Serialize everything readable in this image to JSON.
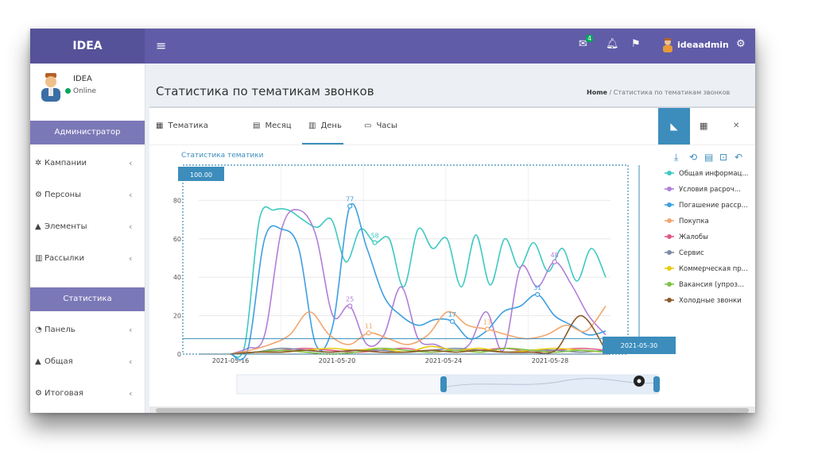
{
  "app": {
    "logo": "IDEA"
  },
  "topbar": {
    "mail_count": "4",
    "username": "ideaadmin"
  },
  "sidebar": {
    "user_name": "IDEA",
    "status": "Online",
    "section1": "Администратор",
    "items1": [
      {
        "label": "Кампании",
        "icon": "cubes-icon"
      },
      {
        "label": "Персоны",
        "icon": "gear-icon"
      },
      {
        "label": "Элементы",
        "icon": "warning-icon"
      },
      {
        "label": "Рассылки",
        "icon": "columns-icon"
      }
    ],
    "section2": "Статистика",
    "items2": [
      {
        "label": "Панель",
        "icon": "dashboard-icon"
      },
      {
        "label": "Общая",
        "icon": "warning-icon"
      },
      {
        "label": "Итоговая",
        "icon": "gear-icon"
      }
    ]
  },
  "content": {
    "page_title": "Статистика по тематикам звонков",
    "breadcrumb_home": "Home",
    "breadcrumb_current": "Статистика по тематикам звонков",
    "tabs": [
      "Тематика",
      "Месяц",
      "День",
      "Часы"
    ],
    "active_tab": "День"
  },
  "chart_data": {
    "type": "line",
    "title": "Статистика тематики",
    "x": [
      "2021-05-16",
      "2021-05-17",
      "2021-05-18",
      "2021-05-19",
      "2021-05-20",
      "2021-05-21",
      "2021-05-22",
      "2021-05-23",
      "2021-05-24",
      "2021-05-25",
      "2021-05-26",
      "2021-05-27",
      "2021-05-28",
      "2021-05-29",
      "2021-05-30"
    ],
    "xticks": [
      "2021-05-16",
      "2021-05-20",
      "2021-05-24",
      "2021-05-28"
    ],
    "ylim": [
      0,
      100
    ],
    "yticks": [
      0,
      20,
      40,
      60,
      80
    ],
    "zoom_start_label": "100.00",
    "zoom_end_label": "2021-05-30",
    "series": [
      {
        "name": "Общая информац...",
        "color": "#3ec9c1",
        "values": [
          0,
          5,
          70,
          75,
          75,
          70,
          66,
          70,
          48,
          65,
          58,
          60,
          35,
          65,
          55,
          60,
          35,
          62,
          36,
          60,
          45,
          58,
          43,
          55,
          38,
          55,
          40
        ]
      },
      {
        "name": "Условия расроч...",
        "color": "#b07fd8",
        "values": [
          0,
          3,
          10,
          65,
          75,
          62,
          20,
          25,
          5,
          10,
          35,
          8,
          5,
          2,
          5,
          22,
          2,
          45,
          35,
          48,
          36,
          20,
          10
        ]
      },
      {
        "name": "Погашение расср...",
        "color": "#3e9fe0",
        "values": [
          0,
          2,
          60,
          65,
          55,
          5,
          15,
          77,
          55,
          30,
          20,
          15,
          18,
          17,
          8,
          12,
          22,
          25,
          31,
          20,
          15,
          10,
          12
        ]
      },
      {
        "name": "Покупка",
        "color": "#f2a66e",
        "values": [
          0,
          2,
          5,
          10,
          22,
          10,
          5,
          11,
          8,
          5,
          10,
          22,
          15,
          13,
          10,
          8,
          10,
          15,
          12,
          25
        ]
      },
      {
        "name": "Жалобы",
        "color": "#e05a86",
        "values": [
          0,
          1,
          2,
          3,
          2,
          1,
          2,
          3,
          1,
          2,
          2,
          3,
          1,
          2,
          3,
          2
        ]
      },
      {
        "name": "Сервис",
        "color": "#7c8aa6",
        "values": [
          0,
          1,
          3,
          2,
          1,
          2,
          2,
          1,
          2,
          3,
          2,
          1,
          2,
          2,
          1,
          2
        ]
      },
      {
        "name": "Коммерческая пр...",
        "color": "#e8cc10",
        "values": [
          0,
          1,
          1,
          2,
          3,
          2,
          3,
          1,
          4,
          2,
          3,
          1,
          2,
          3,
          2,
          1
        ]
      },
      {
        "name": "Вакансия (упроз...",
        "color": "#7fc245",
        "values": [
          0,
          1,
          2,
          1,
          0,
          1,
          3,
          2,
          1,
          2,
          1,
          3,
          2,
          1,
          2,
          1
        ]
      },
      {
        "name": "Холодные звонки",
        "color": "#8b5a2b",
        "values": [
          0,
          1,
          1,
          2,
          1,
          2,
          1,
          1,
          2,
          1,
          2,
          1,
          1,
          2,
          20,
          2
        ]
      }
    ],
    "data_labels": [
      {
        "series": 2,
        "value": 77
      },
      {
        "series": 0,
        "value": 58
      },
      {
        "series": 1,
        "value": 48
      },
      {
        "series": 2,
        "value": 31
      },
      {
        "series": 2,
        "value": 17
      },
      {
        "series": 3,
        "value": 11
      },
      {
        "series": 3,
        "value": 13
      },
      {
        "series": 1,
        "value": 25
      }
    ],
    "legend_position": "right",
    "grid": true,
    "toolbox_icons": [
      "download-icon",
      "restore-icon",
      "dataview-icon",
      "zoom-icon",
      "back-icon"
    ]
  }
}
